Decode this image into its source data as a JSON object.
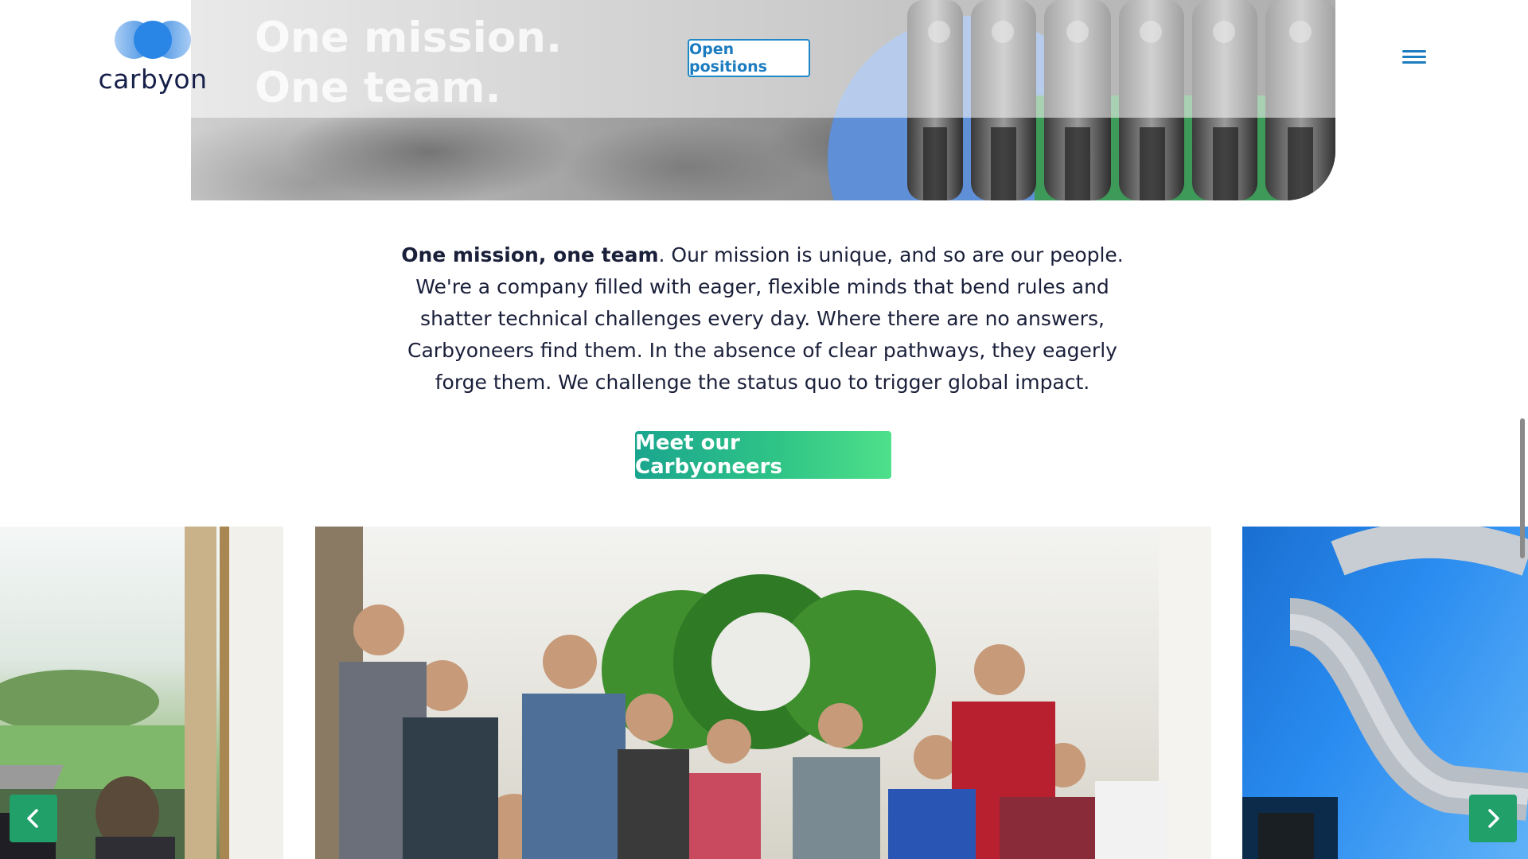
{
  "header": {
    "logo_text": "carbyon",
    "open_positions_label": "Open positions"
  },
  "hero": {
    "title_line1": "One mission.",
    "title_line2": "One team."
  },
  "mission": {
    "lead_bold": "One mission, one team",
    "body": ". Our mission is unique, and so are our people. We're a company filled with eager, flexible minds that bend rules and shatter technical challenges every day. Where there are no answers, Carbyoneers find them. In the absence of clear pathways, they eagerly forge them. We challenge the status quo to trigger global impact."
  },
  "cta": {
    "label": "Meet our Carbyoneers"
  },
  "carousel": {
    "prev_icon": "chevron-left-icon",
    "next_icon": "chevron-right-icon"
  },
  "colors": {
    "brand_navy": "#17204a",
    "brand_blue": "#1b7cc0",
    "cta_green_start": "#1aa58e",
    "cta_green_end": "#4ee08a",
    "arrow_green": "#21a06a"
  }
}
